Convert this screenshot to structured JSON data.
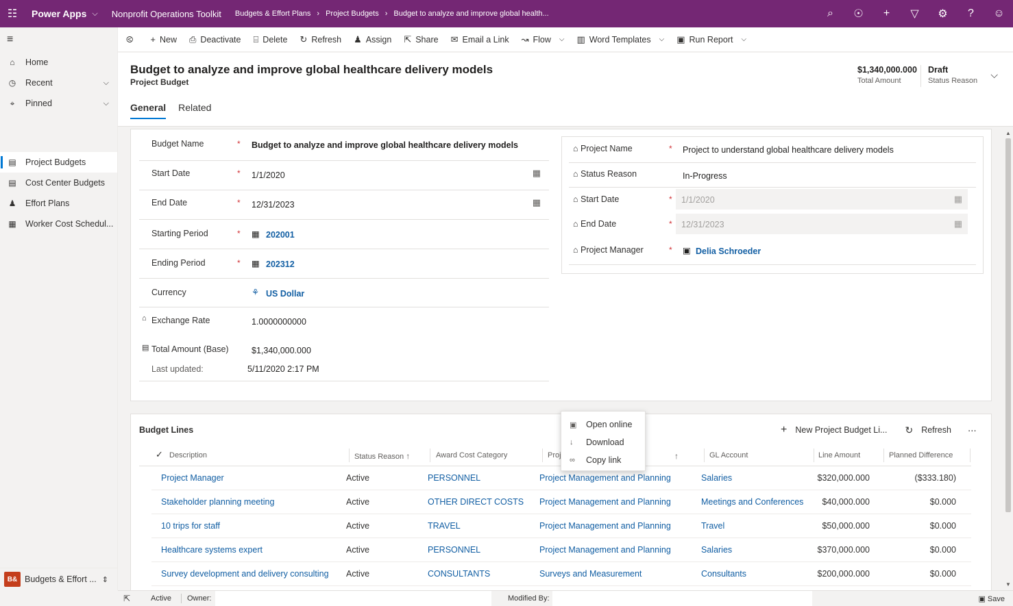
{
  "topbar": {
    "app_name": "Power Apps",
    "env_name": "Nonprofit Operations Toolkit",
    "breadcrumbs": [
      "Budgets & Effort Plans",
      "Project Budgets",
      "Budget to analyze and improve global health..."
    ],
    "icons": [
      "search-icon",
      "task-icon",
      "plus-icon",
      "filter-icon",
      "gear-icon",
      "help-icon",
      "user-icon"
    ]
  },
  "leftnav": {
    "top_items": [
      {
        "label": "Home",
        "icon": "home-icon"
      },
      {
        "label": "Recent",
        "icon": "clock-icon"
      },
      {
        "label": "Pinned",
        "icon": "pin-icon"
      }
    ],
    "entity_items": [
      {
        "label": "Project Budgets",
        "icon": "ledger-icon",
        "selected": true
      },
      {
        "label": "Cost Center Budgets",
        "icon": "ledger-icon"
      },
      {
        "label": "Effort Plans",
        "icon": "people-icon"
      },
      {
        "label": "Worker Cost Schedul...",
        "icon": "calendar-icon"
      }
    ],
    "app_switcher": {
      "badge": "B&",
      "label": "Budgets & Effort ..."
    }
  },
  "commands": {
    "new": "New",
    "deactivate": "Deactivate",
    "delete": "Delete",
    "refresh": "Refresh",
    "assign": "Assign",
    "share": "Share",
    "email_link": "Email a Link",
    "flow": "Flow",
    "word_templates": "Word Templates",
    "run_report": "Run Report"
  },
  "header": {
    "title": "Budget to analyze and improve global healthcare delivery models",
    "entity": "Project Budget",
    "total_amount_value": "$1,340,000.000",
    "total_amount_label": "Total Amount",
    "status_value": "Draft",
    "status_label": "Status Reason",
    "tabs": [
      "General",
      "Related"
    ]
  },
  "form": {
    "budget_name": {
      "label": "Budget Name",
      "value": "Budget to analyze and improve global healthcare delivery models"
    },
    "start_date": {
      "label": "Start Date",
      "value": "1/1/2020"
    },
    "end_date": {
      "label": "End Date",
      "value": "12/31/2023"
    },
    "starting_period": {
      "label": "Starting Period",
      "value": "202001"
    },
    "ending_period": {
      "label": "Ending Period",
      "value": "202312"
    },
    "currency": {
      "label": "Currency",
      "value": "US Dollar"
    },
    "exchange_rate": {
      "label": "Exchange Rate",
      "value": "1.0000000000"
    },
    "total_base": {
      "label": "Total Amount (Base)",
      "value": "$1,340,000.000"
    },
    "last_updated": {
      "label": "Last updated:",
      "value": "5/11/2020 2:17 PM"
    },
    "required_marker": "*"
  },
  "project": {
    "project_name": {
      "label": "Project Name",
      "value": "Project to understand global healthcare delivery models"
    },
    "status_reason": {
      "label": "Status Reason",
      "value": "In-Progress"
    },
    "start_date": {
      "label": "Start Date",
      "value": "1/1/2020"
    },
    "end_date": {
      "label": "End Date",
      "value": "12/31/2023"
    },
    "project_manager": {
      "label": "Project Manager",
      "value": "Delia Schroeder"
    }
  },
  "grid": {
    "title": "Budget Lines",
    "new_label": "New Project Budget Li...",
    "refresh_label": "Refresh",
    "more": "⋯",
    "columns": {
      "description": "Description",
      "status": "Status Reason",
      "award": "Award Cost Category",
      "project": "Proj",
      "gl": "GL Account",
      "line_amount": "Line Amount",
      "planned": "Planned Difference"
    },
    "rows": [
      {
        "description": "Project Manager",
        "status": "Active",
        "award": "PERSONNEL",
        "project": "Project Management and Planning",
        "gl": "Salaries",
        "amount": "$320,000.000",
        "planned": "($333.180)"
      },
      {
        "description": "Stakeholder planning meeting",
        "status": "Active",
        "award": "OTHER DIRECT COSTS",
        "project": "Project Management and Planning",
        "gl": "Meetings and Conferences",
        "amount": "$40,000.000",
        "planned": "$0.000"
      },
      {
        "description": "10 trips for staff",
        "status": "Active",
        "award": "TRAVEL",
        "project": "Project Management and Planning",
        "gl": "Travel",
        "amount": "$50,000.000",
        "planned": "$0.000"
      },
      {
        "description": "Healthcare systems expert",
        "status": "Active",
        "award": "PERSONNEL",
        "project": "Project Management and Planning",
        "gl": "Salaries",
        "amount": "$370,000.000",
        "planned": "$0.000"
      },
      {
        "description": "Survey development and delivery consulting",
        "status": "Active",
        "award": "CONSULTANTS",
        "project": "Surveys and Measurement",
        "gl": "Consultants",
        "amount": "$200,000.000",
        "planned": "$0.000"
      }
    ]
  },
  "popup_menu": [
    "Open online",
    "Download",
    "Copy link"
  ],
  "footer": {
    "status": "Active",
    "owner_label": "Owner:",
    "modified_label": "Modified By:",
    "save_label": "Save"
  },
  "colors": {
    "brand": "#742774",
    "link": "#115ea3",
    "required": "#d13438",
    "accent": "#0078d4"
  }
}
